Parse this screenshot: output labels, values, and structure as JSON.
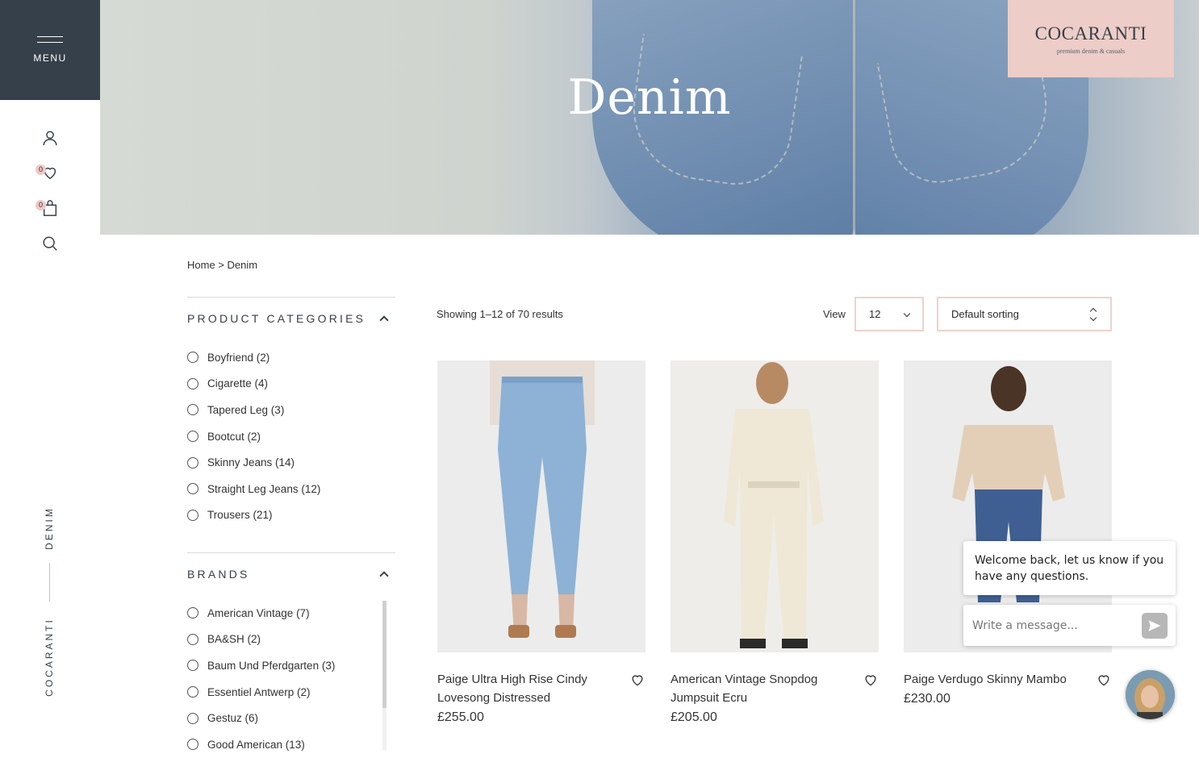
{
  "rail": {
    "menu_label": "MENU",
    "wishlist_count": "0",
    "cart_count": "0",
    "vertical_category": "DENIM",
    "vertical_brand": "COCARANTI"
  },
  "hero": {
    "title": "Denim",
    "logo_main": "COCARANTI",
    "logo_sub": "premium denim & casuals"
  },
  "breadcrumb": {
    "home": "Home",
    "separator": ">",
    "current": "Denim"
  },
  "filters": {
    "categories": {
      "title": "PRODUCT CATEGORIES",
      "items": [
        "Boyfriend (2)",
        "Cigarette (4)",
        "Tapered Leg (3)",
        "Bootcut (2)",
        "Skinny Jeans (14)",
        "Straight Leg Jeans (12)",
        "Trousers (21)"
      ]
    },
    "brands": {
      "title": "BRANDS",
      "items": [
        "American Vintage (7)",
        "BA&SH (2)",
        "Baum Und Pferdgarten (3)",
        "Essentiel Antwerp (2)",
        "Gestuz (6)",
        "Good American (13)"
      ]
    }
  },
  "toolbar": {
    "results": "Showing 1–12 of 70 results",
    "view_label": "View",
    "view_value": "12",
    "sort_value": "Default sorting"
  },
  "products": [
    {
      "name": "Paige Ultra High Rise Cindy Lovesong Distressed",
      "price": "£255.00"
    },
    {
      "name": "American Vintage Snopdog Jumpsuit Ecru",
      "price": "£205.00"
    },
    {
      "name": "Paige Verdugo Skinny Mambo",
      "price": "£230.00"
    }
  ],
  "chat": {
    "message": "Welcome back, let us know if you have any questions.",
    "placeholder": "Write a message..."
  },
  "colors": {
    "rail_dark": "#36404a",
    "accent_pink": "#edcdc7",
    "select_border": "#efd2cd"
  }
}
